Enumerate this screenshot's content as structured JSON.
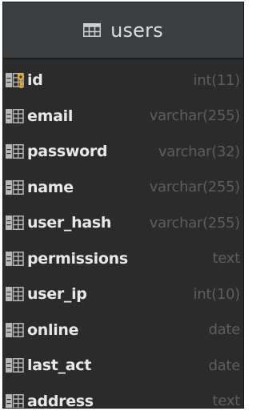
{
  "table": {
    "name": "users",
    "columns": [
      {
        "name": "id",
        "type": "int(11)",
        "primary_key": true
      },
      {
        "name": "email",
        "type": "varchar(255)",
        "primary_key": false
      },
      {
        "name": "password",
        "type": "varchar(32)",
        "primary_key": false
      },
      {
        "name": "name",
        "type": "varchar(255)",
        "primary_key": false
      },
      {
        "name": "user_hash",
        "type": "varchar(255)",
        "primary_key": false
      },
      {
        "name": "permissions",
        "type": "text",
        "primary_key": false
      },
      {
        "name": "user_ip",
        "type": "int(10)",
        "primary_key": false
      },
      {
        "name": "online",
        "type": "date",
        "primary_key": false
      },
      {
        "name": "last_act",
        "type": "date",
        "primary_key": false
      },
      {
        "name": "address",
        "type": "text",
        "primary_key": false
      }
    ]
  },
  "colors": {
    "background": "#2b2b2b",
    "header_background": "#3c3f41",
    "column_name": "#e8e8e8",
    "column_type": "#5e5e5e",
    "key_icon": "#e3a82b",
    "column_icon": "#b7b7b7"
  }
}
